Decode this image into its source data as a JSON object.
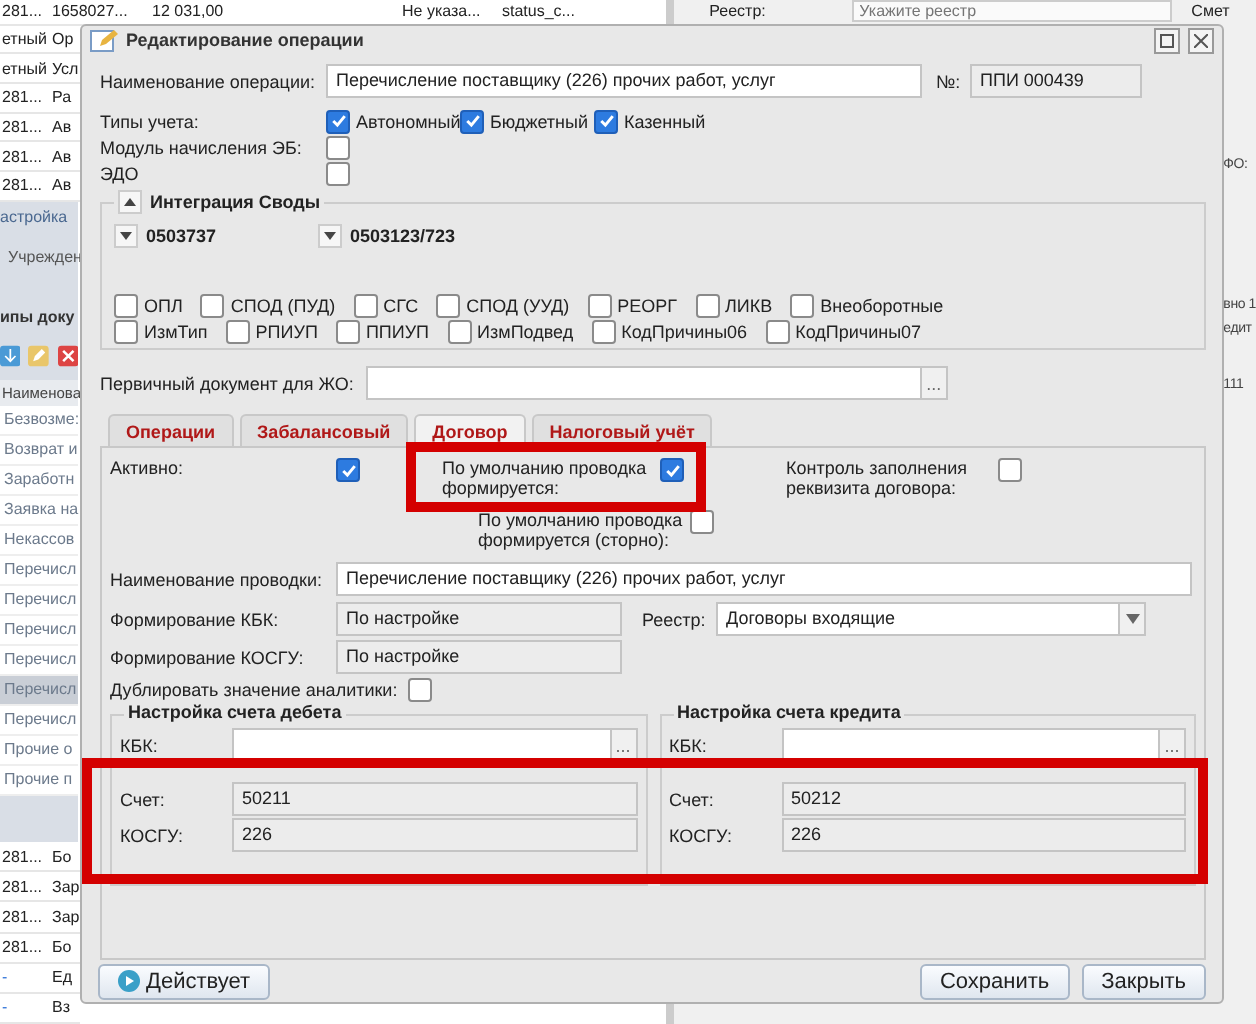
{
  "background": {
    "top_rows": [
      [
        "281...",
        "1658027...",
        "12 031,00",
        "Не указа...",
        "status_c..."
      ],
      [
        "етный",
        "Ор"
      ],
      [
        "етный",
        "Усл"
      ],
      [
        "281...",
        "Ра"
      ],
      [
        "281...",
        "Ав"
      ],
      [
        "281...",
        "Ав"
      ],
      [
        "281...",
        "Ав"
      ]
    ],
    "settings_panel": {
      "title": "астройка",
      "institution_label": "Учрежден",
      "doc_types_title": "ипы доку",
      "column_header": "Наименова",
      "items": [
        {
          "label": "Безвозме:",
          "selected": false
        },
        {
          "label": "Возврат и",
          "selected": false
        },
        {
          "label": "Заработн",
          "selected": false
        },
        {
          "label": "Заявка на",
          "selected": false
        },
        {
          "label": "Некассов",
          "selected": false
        },
        {
          "label": "Перечисл",
          "selected": false
        },
        {
          "label": "Перечисл",
          "selected": false
        },
        {
          "label": "Перечисл",
          "selected": false
        },
        {
          "label": "Перечисл",
          "selected": false
        },
        {
          "label": "Перечисл",
          "selected": true
        },
        {
          "label": "Перечисл",
          "selected": false
        },
        {
          "label": "Прочие о",
          "selected": false
        },
        {
          "label": "Прочие п",
          "selected": false
        }
      ]
    },
    "bottom_rows": [
      [
        "281...",
        "Бо"
      ],
      [
        "281...",
        "Зар"
      ],
      [
        "281...",
        "Зар"
      ],
      [
        "281...",
        "Бо"
      ],
      [
        "-",
        "Ед"
      ],
      [
        "-",
        "Вз"
      ]
    ],
    "right_panel": {
      "registry_label": "Реестр:",
      "registry_placeholder": "Укажите реестр",
      "estimate_label": "Смет",
      "fo_label": "ФО:",
      "fragments": [
        "вно 1",
        "едит",
        "111"
      ]
    }
  },
  "dialog": {
    "title": "Редактирование операции",
    "operation_name_label": "Наименование операции:",
    "operation_name": "Перечисление поставщику (226) прочих работ, услуг",
    "number_label": "№:",
    "number": "ППИ 000439",
    "accounting_types_label": "Типы учета:",
    "accounting_types": [
      {
        "label": "Автономный",
        "checked": true
      },
      {
        "label": "Бюджетный",
        "checked": true
      },
      {
        "label": "Казенный",
        "checked": true
      }
    ],
    "flags": [
      {
        "label": "Модуль начисления ЭБ:",
        "checked": false
      },
      {
        "label": "ЭДО",
        "checked": false
      }
    ],
    "integration": {
      "title": "Интеграция Своды",
      "expanded": true,
      "forms": [
        {
          "label": "0503737",
          "expanded": false
        },
        {
          "label": "0503123/723",
          "expanded": false
        }
      ],
      "options": [
        [
          {
            "label": "ОПЛ",
            "checked": false
          },
          {
            "label": "СПОД (ПУД)",
            "checked": false
          },
          {
            "label": "СГС",
            "checked": false
          },
          {
            "label": "СПОД (УУД)",
            "checked": false
          },
          {
            "label": "РЕОРГ",
            "checked": false
          },
          {
            "label": "ЛИКВ",
            "checked": false
          },
          {
            "label": "Внеоборотные",
            "checked": false
          }
        ],
        [
          {
            "label": "ИзмТип",
            "checked": false
          },
          {
            "label": "РПИУП",
            "checked": false
          },
          {
            "label": "ППИУП",
            "checked": false
          },
          {
            "label": "ИзмПодвед",
            "checked": false
          },
          {
            "label": "КодПричины06",
            "checked": false
          },
          {
            "label": "КодПричины07",
            "checked": false
          }
        ]
      ]
    },
    "primary_doc_label": "Первичный документ для ЖО:",
    "primary_doc_button": "...",
    "tabs": [
      {
        "label": "Операции",
        "selected": false
      },
      {
        "label": "Забалансовый",
        "selected": false
      },
      {
        "label": "Договор",
        "selected": true
      },
      {
        "label": "Налоговый учёт",
        "selected": false
      }
    ],
    "contract_tab": {
      "active": {
        "label": "Активно:",
        "checked": true
      },
      "default_posting": {
        "label": "По умолчанию проводка формируется:",
        "checked": true
      },
      "contract_control": {
        "label": "Контроль заполнения реквизита договора:",
        "checked": false
      },
      "default_reversal": {
        "label": "По умолчанию проводка формируется (сторно):",
        "checked": false
      },
      "posting_name_label": "Наименование проводки:",
      "posting_name": "Перечисление поставщику (226) прочих работ, услуг",
      "kbk_label": "Формирование КБК:",
      "kbk": "По настройке",
      "registry_label": "Реестр:",
      "registry": "Договоры входящие",
      "kosgu_label": "Формирование КОСГУ:",
      "kosgu": "По настройке",
      "duplicate": {
        "label": "Дублировать значение аналитики:",
        "checked": false
      },
      "accounts": [
        {
          "title": "Настройка счета дебета",
          "kbk_label": "КБК:",
          "kbk_button": "...",
          "account_label": "Счет:",
          "account": "50211",
          "kosgu_label": "КОСГУ:",
          "kosgu": "226"
        },
        {
          "title": "Настройка счета кредита",
          "kbk_label": "КБК:",
          "kbk_button": "...",
          "account_label": "Счет:",
          "account": "50212",
          "kosgu_label": "КОСГУ:",
          "kosgu": "226"
        }
      ]
    },
    "status_button": "Действует",
    "buttons": [
      "Сохранить",
      "Закрыть"
    ]
  }
}
